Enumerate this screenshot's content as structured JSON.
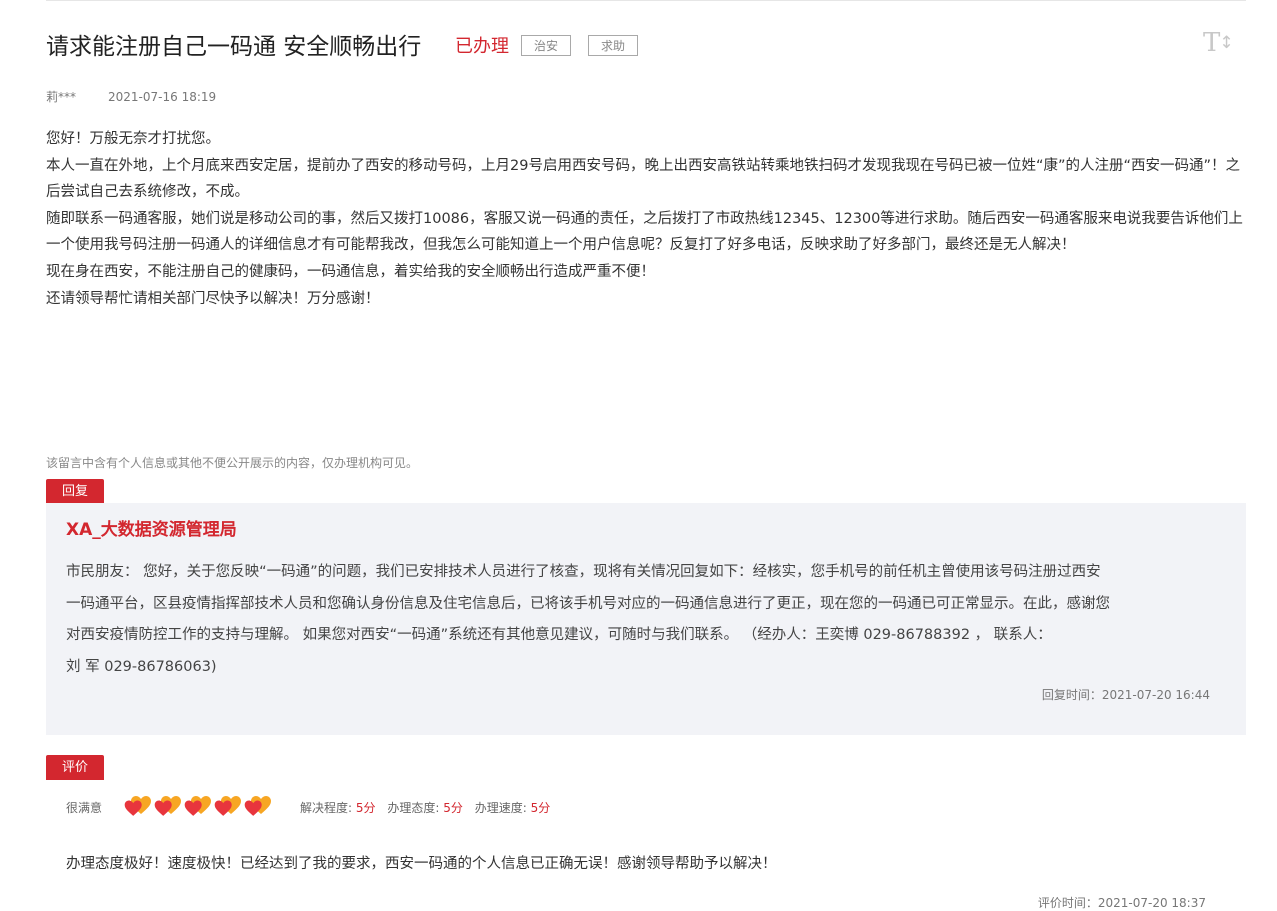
{
  "header": {
    "title": "请求能注册自己一码通 安全顺畅出行",
    "status": "已办理",
    "tags": [
      "治安",
      "求助"
    ],
    "font_size_icon": "text-size-icon"
  },
  "meta": {
    "author": "莉***",
    "date": "2021-07-16 18:19"
  },
  "body": {
    "paragraphs": [
      "您好！万般无奈才打扰您。",
      "本人一直在外地，上个月底来西安定居，提前办了西安的移动号码，上月29号启用西安号码，晚上出西安高铁站转乘地铁扫码才发现我现在号码已被一位姓“康”的人注册“西安一码通”！之后尝试自己去系统修改，不成。",
      "随即联系一码通客服，她们说是移动公司的事，然后又拨打10086，客服又说一码通的责任，之后拨打了市政热线12345、12300等进行求助。随后西安一码通客服来电说我要告诉他们上一个使用我号码注册一码通人的详细信息才有可能帮我改，但我怎么可能知道上一个用户信息呢？反复打了好多电话，反映求助了好多部门，最终还是无人解决！",
      "现在身在西安，不能注册自己的健康码，一码通信息，着实给我的安全顺畅出行造成严重不便！",
      "还请领导帮忙请相关部门尽快予以解决！万分感谢！"
    ],
    "privacy_note": "该留言中含有个人信息或其他不便公开展示的内容，仅办理机构可见。"
  },
  "reply": {
    "label": "回复",
    "org": "XA_大数据资源管理局",
    "lines": [
      "市民朋友： 您好，关于您反映“一码通”的问题，我们已安排技术人员进行了核查，现将有关情况回复如下：经核实，您手机号的前任机主曾使用该号码注册过西安",
      "一码通平台，区县疫情指挥部技术人员和您确认身份信息及住宅信息后，已将该手机号对应的一码通信息进行了更正，现在您的一码通已可正常显示。在此，感谢您",
      "对西安疫情防控工作的支持与理解。 如果您对西安“一码通”系统还有其他意见建议，可随时与我们联系。 （经办人：王奕博 029-86788392 ， 联系人：",
      "刘 军 029-86786063)"
    ],
    "time": "回复时间：2021-07-20 16:44"
  },
  "evaluation": {
    "label": "评价",
    "satisfaction": "很满意",
    "hearts": 5,
    "heart_icon": "heart-icon",
    "heart_color": "#e8353d",
    "heart_back_color": "#f7a623",
    "scores": [
      {
        "name": "解决程度:",
        "value": "5分"
      },
      {
        "name": "办理态度:",
        "value": "5分"
      },
      {
        "name": "办理速度:",
        "value": "5分"
      }
    ],
    "comment": "办理态度极好！速度极快！已经达到了我的要求，西安一码通的个人信息已正确无误！感谢领导帮助予以解决！",
    "time": "评价时间：2021-07-20 18:37"
  }
}
